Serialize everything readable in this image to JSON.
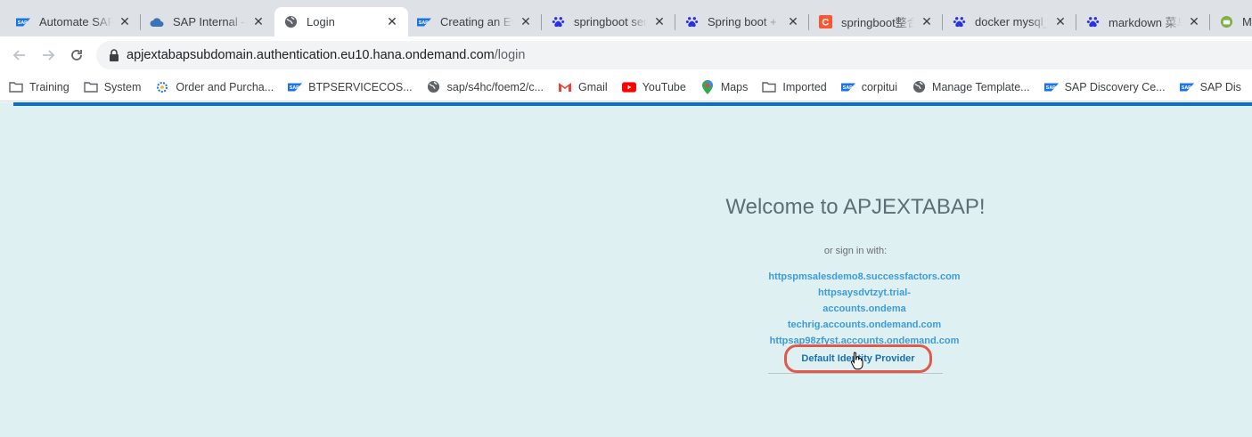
{
  "browser": {
    "tabs": [
      {
        "title": "Automate SAP",
        "favicon": "sap-logo-icon",
        "active": false
      },
      {
        "title": "SAP Internal -",
        "favicon": "cloud-icon",
        "active": false
      },
      {
        "title": "Login",
        "favicon": "globe-icon",
        "active": true
      },
      {
        "title": "Creating an Ev",
        "favicon": "sap-logo-icon",
        "active": false
      },
      {
        "title": "springboot ser",
        "favicon": "baidu-paw-icon",
        "active": false
      },
      {
        "title": "Spring boot +",
        "favicon": "baidu-paw-icon",
        "active": false
      },
      {
        "title": "springboot整合",
        "favicon": "csdn-c-icon",
        "active": false
      },
      {
        "title": "docker mysql_",
        "favicon": "baidu-paw-icon",
        "active": false
      },
      {
        "title": "markdown 菜鸟",
        "favicon": "baidu-paw-icon",
        "active": false
      },
      {
        "title": "Mar",
        "favicon": "android-icon",
        "active": false
      }
    ],
    "url": {
      "host": "apjextabapsubdomain.authentication.eu10.hana.ondemand.com",
      "path": "/login"
    },
    "bookmarks": [
      {
        "label": "Training",
        "icon": "folder-icon"
      },
      {
        "label": "System",
        "icon": "folder-icon"
      },
      {
        "label": "Order and Purcha...",
        "icon": "gear-bookmark-icon"
      },
      {
        "label": "BTPSERVICECOS...",
        "icon": "sap-logo-icon"
      },
      {
        "label": "sap/s4hc/foem2/c...",
        "icon": "globe-icon"
      },
      {
        "label": "Gmail",
        "icon": "gmail-icon"
      },
      {
        "label": "YouTube",
        "icon": "youtube-icon"
      },
      {
        "label": "Maps",
        "icon": "maps-icon"
      },
      {
        "label": "Imported",
        "icon": "folder-icon"
      },
      {
        "label": "corpitui",
        "icon": "sap-logo-icon"
      },
      {
        "label": "Manage Template...",
        "icon": "globe-icon"
      },
      {
        "label": "SAP Discovery Ce...",
        "icon": "sap-logo-icon"
      },
      {
        "label": "SAP Dis",
        "icon": "sap-logo-icon"
      }
    ]
  },
  "login": {
    "welcome": "Welcome to APJEXTABAP!",
    "signin_label": "or sign in with:",
    "idps": [
      "httpspmsalesdemo8.successfactors.com",
      "httpsaysdvtzyt.trial-",
      "accounts.ondema",
      "techrig.accounts.ondemand.com",
      "httpsap98zfyst.accounts.ondemand.com"
    ],
    "default_idp": "Default Identity Provider"
  },
  "colors": {
    "page_bg": "#dff0f3",
    "link": "#3e9bd8",
    "accent_bar": "#0a6ed1",
    "highlight": "#e05a4b"
  }
}
